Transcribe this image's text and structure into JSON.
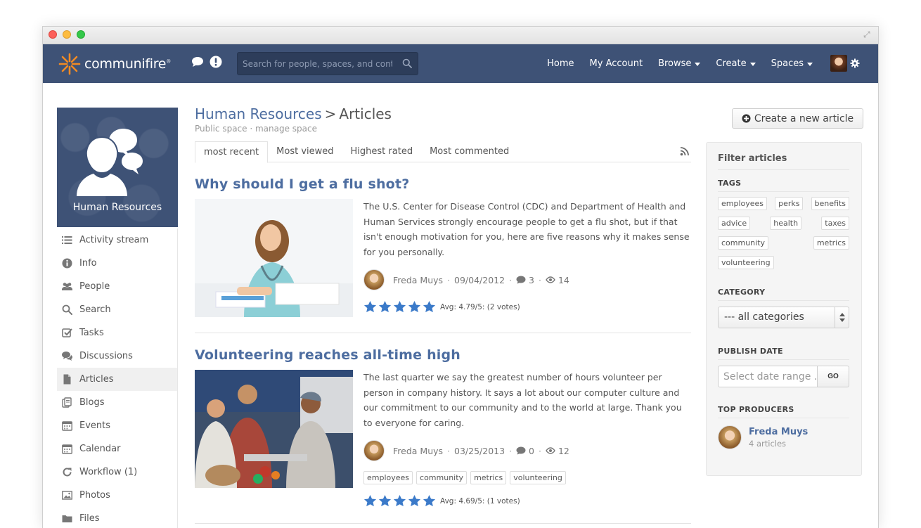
{
  "app": {
    "logo_text": "communifire",
    "logo_mark": "®"
  },
  "search": {
    "placeholder": "Search for people, spaces, and content"
  },
  "nav": {
    "home": "Home",
    "my_account": "My Account",
    "browse": "Browse",
    "create": "Create",
    "spaces": "Spaces"
  },
  "space": {
    "name": "Human Resources"
  },
  "sidebar": {
    "items": [
      {
        "label": "Activity stream",
        "icon": "list-icon"
      },
      {
        "label": "Info",
        "icon": "info-icon"
      },
      {
        "label": "People",
        "icon": "people-icon"
      },
      {
        "label": "Search",
        "icon": "search-icon"
      },
      {
        "label": "Tasks",
        "icon": "checkbox-icon"
      },
      {
        "label": "Discussions",
        "icon": "chat-icon"
      },
      {
        "label": "Articles",
        "icon": "document-icon"
      },
      {
        "label": "Blogs",
        "icon": "blog-icon"
      },
      {
        "label": "Events",
        "icon": "calendar-icon"
      },
      {
        "label": "Calendar",
        "icon": "calendar-icon"
      },
      {
        "label": "Workflow (1)",
        "icon": "refresh-icon"
      },
      {
        "label": "Photos",
        "icon": "photo-icon"
      },
      {
        "label": "Files",
        "icon": "folder-icon"
      }
    ],
    "active_index": 6
  },
  "header": {
    "space_link": "Human Resources",
    "separator": ">",
    "section": "Articles",
    "subline": "Public space · manage space"
  },
  "tabs": [
    "most recent",
    "Most viewed",
    "Highest rated",
    "Most commented"
  ],
  "articles": [
    {
      "title": "Why should I get a flu shot?",
      "excerpt": "The U.S. Center for Disease Control (CDC) and Department of Health and Human Services strongly encourage people to get a flu shot, but if that isn't enough motivation for you, here are five reasons why it makes sense for you personally.",
      "author": "Freda Muys",
      "date": "09/04/2012",
      "comments": "3",
      "views": "14",
      "rating": "Avg: 4.79/5: (2 votes)",
      "stars": 5,
      "tags": []
    },
    {
      "title": "Volunteering reaches all-time high",
      "excerpt": "The last quarter we say the greatest number of hours volunteer per person in company history. It says a lot about our computer culture and our commitment to our community and to the world at large. Thank you to everyone for caring.",
      "author": "Freda Muys",
      "date": "03/25/2013",
      "comments": "0",
      "views": "12",
      "rating": "Avg: 4.69/5: (1 votes)",
      "stars": 5,
      "tags": [
        "employees",
        "community",
        "metrics",
        "volunteering"
      ]
    }
  ],
  "create_button": "Create a new article",
  "filter": {
    "title": "Filter articles",
    "tags_heading": "TAGS",
    "tags": [
      "employees",
      "perks",
      "benefits",
      "advice",
      "health",
      "taxes",
      "community",
      "metrics",
      "volunteering"
    ],
    "category_heading": "CATEGORY",
    "category_value": "--- all categories",
    "publish_heading": "PUBLISH DATE",
    "date_placeholder": "Select date range ..",
    "go_label": "GO",
    "producers_heading": "TOP PRODUCERS",
    "producer_name": "Freda Muys",
    "producer_count": "4 articles"
  },
  "colors": {
    "nav_bg": "#3e5276",
    "link": "#4d6da0",
    "star": "#3b7ac9",
    "logo_orange": "#f08a24"
  }
}
